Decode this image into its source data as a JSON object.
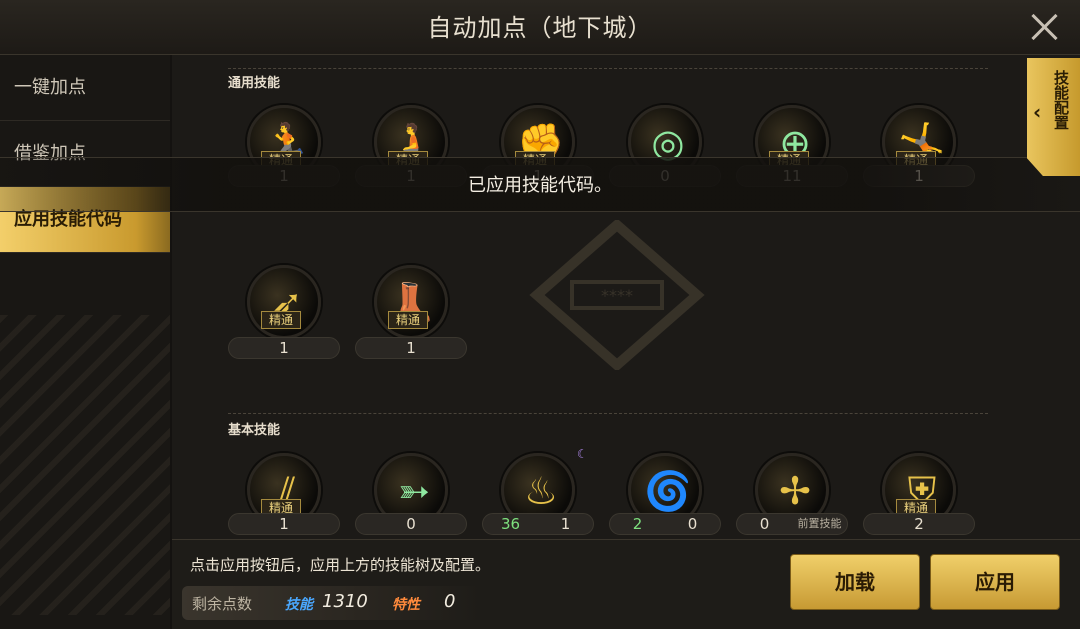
{
  "header": {
    "title": "自动加点（地下城）"
  },
  "sidebar": {
    "items": [
      {
        "label": "一键加点"
      },
      {
        "label": "借鉴加点"
      },
      {
        "label": "应用技能代码"
      }
    ],
    "active_index": 2
  },
  "right_tab": {
    "label": "技能配置"
  },
  "toast": {
    "message": "已应用技能代码。"
  },
  "sections": {
    "common": {
      "label": "通用技能"
    },
    "basic": {
      "label": "基本技能"
    }
  },
  "skills": {
    "common_row1": [
      {
        "level": "1",
        "badge": "精通",
        "icon": "running-man-icon"
      },
      {
        "level": "1",
        "badge": "精通",
        "icon": "crouching-man-icon"
      },
      {
        "level": "1",
        "badge": "精通",
        "icon": "punch-icon"
      },
      {
        "level": "0",
        "badge": "",
        "icon": "target-icon"
      },
      {
        "level": "11",
        "badge": "精通",
        "icon": "target-gear-icon"
      },
      {
        "level": "1",
        "badge": "精通",
        "icon": "jumping-man-icon"
      }
    ],
    "common_row2": [
      {
        "level": "1",
        "badge": "精通",
        "icon": "wing-slash-icon"
      },
      {
        "level": "1",
        "badge": "精通",
        "icon": "boot-kick-icon"
      }
    ],
    "basic_row": [
      {
        "level": "1",
        "badge": "精通",
        "icon": "claw-slash-icon"
      },
      {
        "level": "0",
        "badge": "",
        "icon": "arrow-burst-icon"
      },
      {
        "level_a": "36",
        "level_b": "1",
        "badge": "",
        "icon": "flame-claw-icon"
      },
      {
        "level_a": "2",
        "level_b": "0",
        "badge": "",
        "icon": "vortex-icon"
      },
      {
        "level_a": "0",
        "level_b": "前置技能",
        "badge": "",
        "icon": "cross-slash-icon"
      },
      {
        "level": "2",
        "badge": "精通",
        "icon": "shield-icon"
      }
    ]
  },
  "footer": {
    "hint": "点击应用按钮后，应用上方的技能树及配置。",
    "points_label": "剩余点数",
    "skill_tag": "技能",
    "skill_points": "1310",
    "trait_tag": "特性",
    "trait_points": "0",
    "load_label": "加载",
    "apply_label": "应用"
  },
  "colors": {
    "accent": "#e3b84c",
    "skill_tag": "#4aa8ff",
    "trait_tag": "#ff8a3c",
    "green_value": "#7ee07e"
  }
}
